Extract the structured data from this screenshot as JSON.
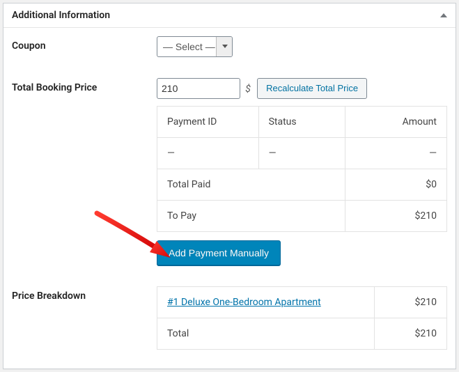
{
  "panel": {
    "title": "Additional Information"
  },
  "coupon": {
    "label": "Coupon",
    "selected": "— Select —"
  },
  "booking_price": {
    "label": "Total Booking Price",
    "value": "210",
    "currency": "$",
    "recalc_label": "Recalculate Total Price"
  },
  "payments": {
    "headers": {
      "id": "Payment ID",
      "status": "Status",
      "amount": "Amount"
    },
    "rows": [
      {
        "id": "—",
        "status": "—",
        "amount": "—"
      }
    ],
    "total_paid_label": "Total Paid",
    "total_paid_value": "$0",
    "to_pay_label": "To Pay",
    "to_pay_value": "$210",
    "add_manually_label": "Add Payment Manually"
  },
  "breakdown": {
    "label": "Price Breakdown",
    "items": [
      {
        "name": "#1 Deluxe One-Bedroom Apartment",
        "amount": "$210"
      }
    ],
    "total_label": "Total",
    "total_value": "$210"
  }
}
